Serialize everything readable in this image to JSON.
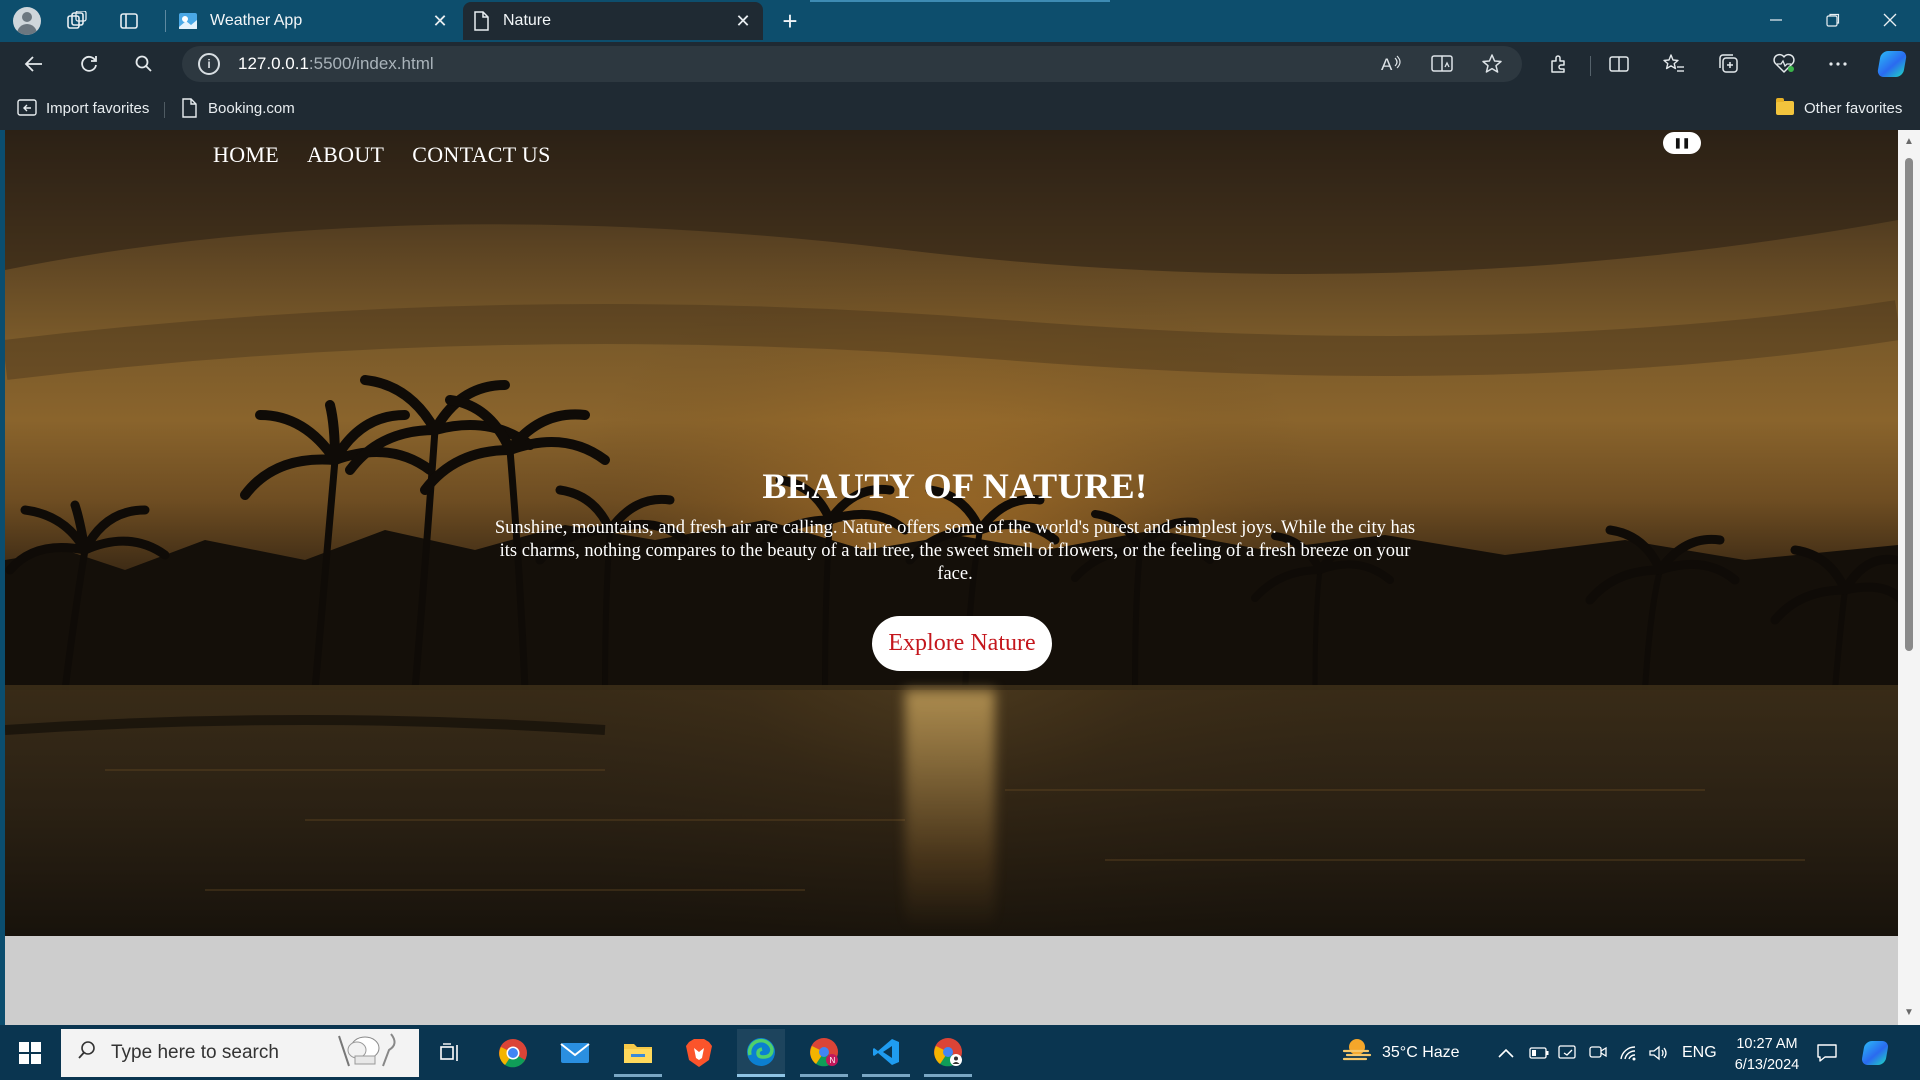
{
  "browser": {
    "tabs": [
      {
        "title": "Weather App",
        "active": false
      },
      {
        "title": "Nature",
        "active": true
      }
    ],
    "address": {
      "host": "127.0.0.1",
      "rest": ":5500/index.html"
    },
    "favorites": [
      {
        "label": "Import favorites",
        "icon": "import-favorites-icon"
      },
      {
        "label": "Booking.com",
        "icon": "page-icon"
      }
    ],
    "other_favorites": "Other favorites",
    "accent": "#0d4e6d"
  },
  "page": {
    "nav": [
      "HOME",
      "ABOUT",
      "CONTACT US"
    ],
    "toggle_label": "❚❚",
    "hero_title": "BEAUTY OF NATURE!",
    "hero_text": "Sunshine, mountains, and fresh air are calling. Nature offers some of the world's purest and simplest joys. While the city has its charms, nothing compares to the beauty of a tall tree, the sweet smell of flowers, or the feeling of a fresh breeze on your face.",
    "cta_label": "Explore Nature",
    "cta_color": "#c4161c"
  },
  "taskbar": {
    "search_placeholder": "Type here to search",
    "weather": "35°C  Haze",
    "language": "ENG",
    "time": "10:27 AM",
    "date": "6/13/2024",
    "apps": [
      "task-view",
      "chrome",
      "mail",
      "file-explorer",
      "brave",
      "edge",
      "chrome-profile",
      "vscode",
      "chrome-profile-2"
    ]
  }
}
